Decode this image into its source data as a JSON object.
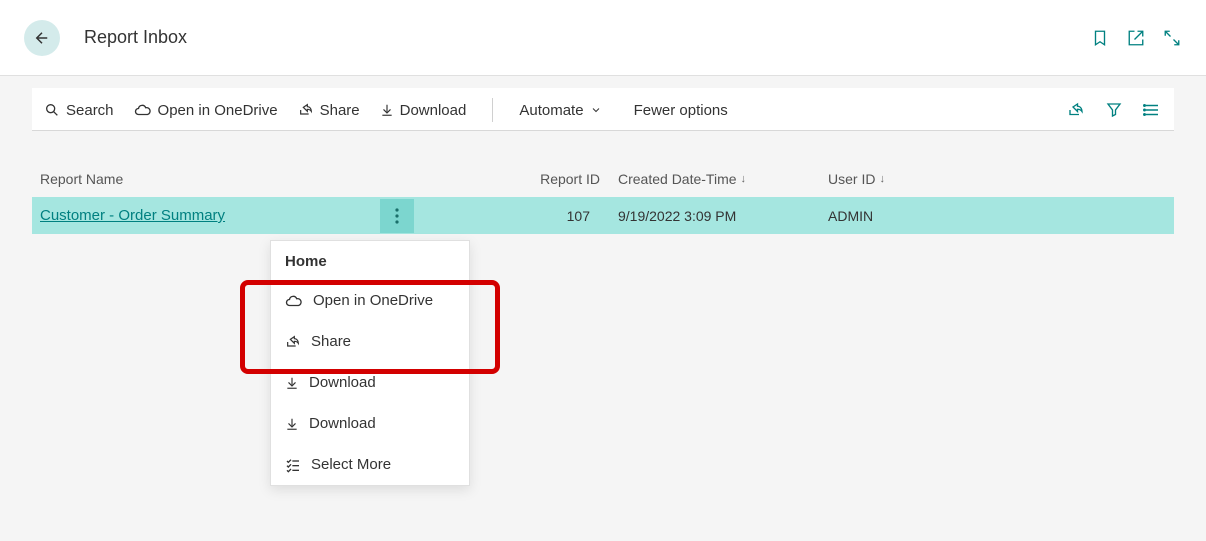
{
  "header": {
    "title": "Report Inbox"
  },
  "toolbar": {
    "search": "Search",
    "open_onedrive": "Open in OneDrive",
    "share": "Share",
    "download": "Download",
    "automate": "Automate",
    "fewer_options": "Fewer options"
  },
  "table": {
    "columns": {
      "report_name": "Report Name",
      "report_id": "Report ID",
      "created": "Created Date-Time",
      "user_id": "User ID"
    },
    "rows": [
      {
        "name": "Customer - Order Summary",
        "id": "107",
        "created": "9/19/2022 3:09 PM",
        "user": "ADMIN"
      }
    ]
  },
  "menu": {
    "header": "Home",
    "open_onedrive": "Open in OneDrive",
    "share": "Share",
    "download1": "Download",
    "download2": "Download",
    "select_more": "Select More"
  }
}
